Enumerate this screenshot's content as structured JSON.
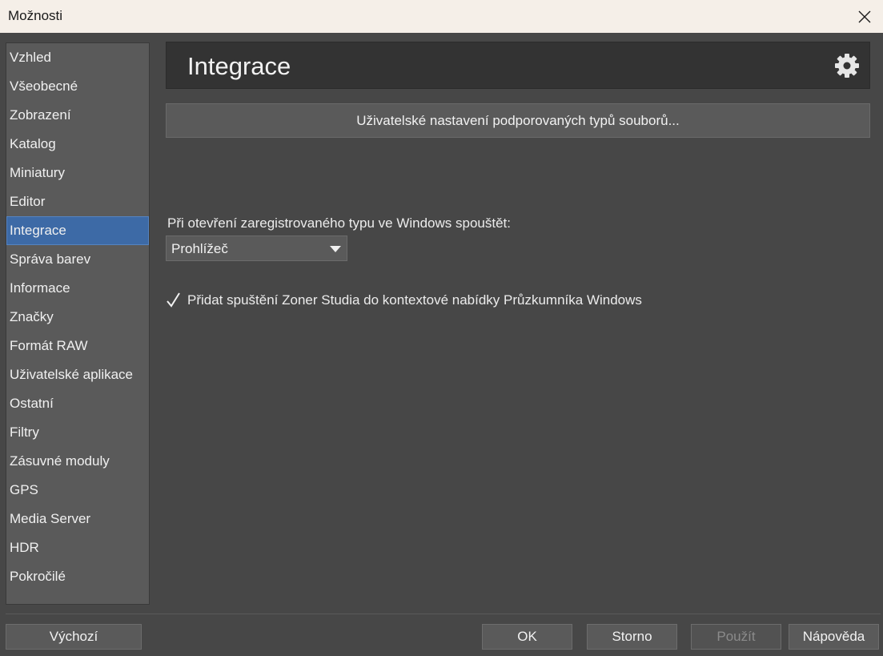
{
  "window": {
    "title": "Možnosti"
  },
  "sidebar": {
    "items": [
      {
        "label": "Vzhled"
      },
      {
        "label": "Všeobecné"
      },
      {
        "label": "Zobrazení"
      },
      {
        "label": "Katalog"
      },
      {
        "label": "Miniatury"
      },
      {
        "label": "Editor"
      },
      {
        "label": "Integrace"
      },
      {
        "label": "Správa barev"
      },
      {
        "label": "Informace"
      },
      {
        "label": "Značky"
      },
      {
        "label": "Formát RAW"
      },
      {
        "label": "Uživatelské aplikace"
      },
      {
        "label": "Ostatní"
      },
      {
        "label": "Filtry"
      },
      {
        "label": "Zásuvné moduly"
      },
      {
        "label": "GPS"
      },
      {
        "label": "Media Server"
      },
      {
        "label": "HDR"
      },
      {
        "label": "Pokročilé"
      }
    ],
    "selected": "Integrace"
  },
  "panel": {
    "title": "Integrace",
    "types_button": "Uživatelské nastavení podporovaných typů souborů...",
    "open_label": "Při otevření zaregistrovaného typu ve Windows spouštět:",
    "open_select_value": "Prohlížeč",
    "context_menu_checkbox": {
      "label": "Přidat spuštění Zoner Studia do kontextové nabídky Průzkumníka Windows",
      "checked": true
    }
  },
  "footer": {
    "default_button": "Výchozí",
    "ok_button": "OK",
    "cancel_button": "Storno",
    "apply_button": "Použít",
    "help_button": "Nápověda"
  },
  "colors": {
    "accent": "#3d6aa6",
    "background": "#474747",
    "titlebar": "#f5efe8"
  },
  "icons": {
    "close": "close-icon",
    "settings": "gear-icon",
    "dropdown": "chevron-down-icon",
    "checkbox": "checkmark-icon"
  }
}
